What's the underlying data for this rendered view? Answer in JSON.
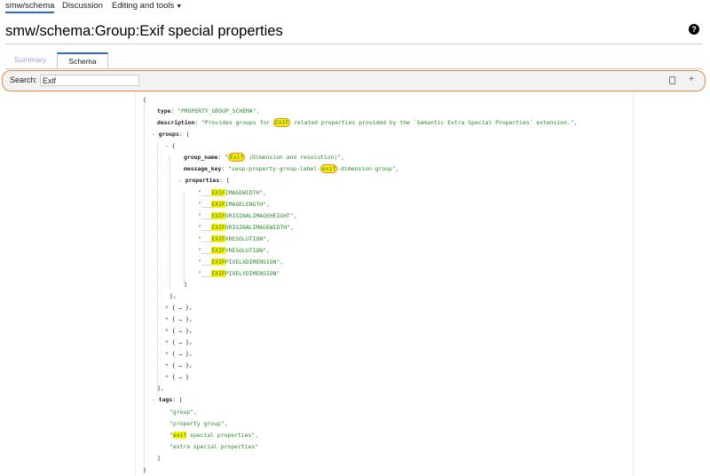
{
  "nav": {
    "page_label": "smw/schema",
    "discussion_label": "Discussion",
    "tools_label": "Editing and tools"
  },
  "title": "smw/schema:Group:Exif special properties",
  "help_icon": "?",
  "tabs": {
    "summary": "Summary",
    "schema": "Schema"
  },
  "search": {
    "label": "Search:",
    "value": "Exif"
  },
  "toolbar": {
    "copy_icon": "copy-icon",
    "add_icon": "+"
  },
  "json": {
    "open": "{",
    "type_key": "type",
    "type_value": "\"PROPERTY_GROUP_SCHEMA\",",
    "description_key": "description",
    "description_pre": "\"Provides groups for ",
    "description_hl": "EXIF",
    "description_post": " related properties provided by the `Semantic Extra Special Properties` extension.\",",
    "groups_key": "groups",
    "group_open": "{",
    "group_name_key": "group_name",
    "group_name_pre": "\"",
    "group_name_hl": "Exif",
    "group_name_post": " (Dimension and resolution)\",",
    "message_key_key": "message_key",
    "message_key_pre": "\"sesp-property-group-label-",
    "message_key_hl": "exif",
    "message_key_post": "-dimension-group\",",
    "properties_key": "properties",
    "property_prefix": "\"___",
    "property_hl": "EXIF",
    "properties": [
      "IMAGEWIDTH\",",
      "IMAGELENGTH\",",
      "ORIGINALIMAGEHEIGHT\",",
      "ORIGINALIMAGEWIDTH\",",
      "XRESOLUTION\",",
      "YRESOLUTION\",",
      "PIXELXDIMENSION\",",
      "PIXELYDIMENSION\""
    ],
    "properties_close": "]",
    "group_close": "},",
    "collapsed_groups": [
      "{ … },",
      "{ … },",
      "{ … },",
      "{ … },",
      "{ … },",
      "{ … },",
      "{ … }"
    ],
    "groups_close": "],",
    "tags_key": "tags",
    "tag_group": "\"group\",",
    "tag_property_group": "\"property group\",",
    "tag_exif_pre": "\"",
    "tag_exif_hl": "exif",
    "tag_exif_post": " special properties\",",
    "tag_extra": "\"extra special properties\"",
    "tags_close": "]",
    "close": "}"
  }
}
